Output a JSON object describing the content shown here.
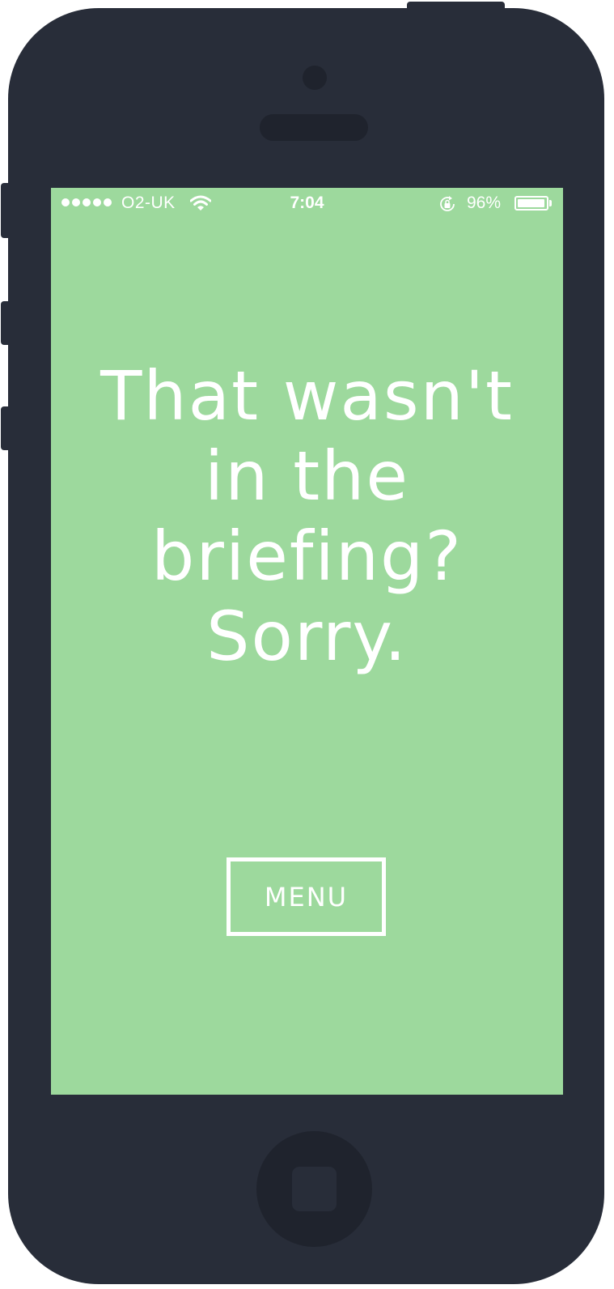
{
  "status_bar": {
    "carrier": "O2-UK",
    "signal_bars": 5,
    "time": "7:04",
    "battery_percent": "96%",
    "battery_level": 0.96
  },
  "main": {
    "headline_lines": [
      "That wasn't",
      "in the",
      "briefing?",
      "Sorry."
    ]
  },
  "menu_button": {
    "label": "MENU"
  },
  "colors": {
    "screen_background": "#9dd99d",
    "device_body": "#282d39",
    "text": "#ffffff"
  },
  "icons": {
    "wifi": "wifi-icon",
    "orientation_lock": "orientation-lock-icon",
    "battery": "battery-icon"
  }
}
